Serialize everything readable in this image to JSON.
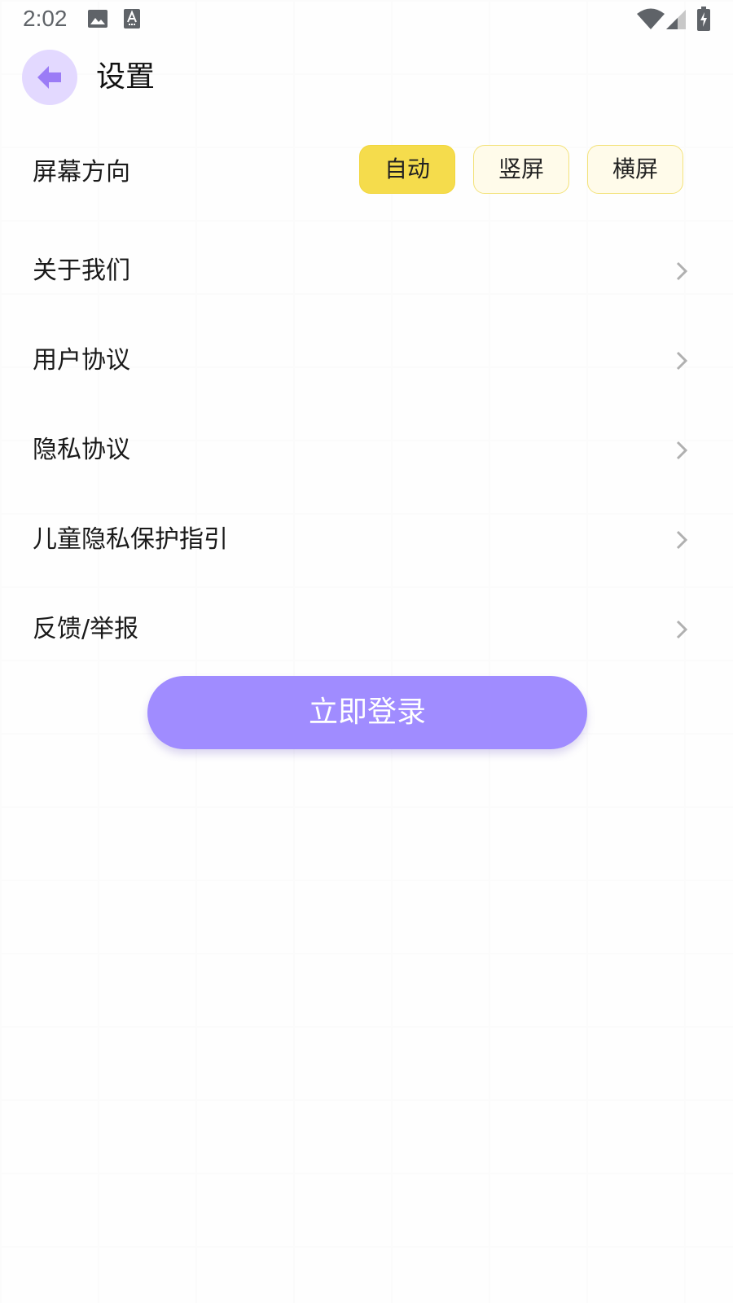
{
  "status_bar": {
    "time": "2:02",
    "icons": [
      "image-icon",
      "a-text-icon",
      "wifi-icon",
      "cell-signal-icon",
      "battery-charging-icon"
    ]
  },
  "header": {
    "back_icon": "arrow-left-icon",
    "title": "设置"
  },
  "orientation": {
    "label": "屏幕方向",
    "options": [
      "自动",
      "竖屏",
      "横屏"
    ],
    "selected": "自动"
  },
  "menu": {
    "items": [
      {
        "label": "关于我们"
      },
      {
        "label": "用户协议"
      },
      {
        "label": "隐私协议"
      },
      {
        "label": "儿童隐私保护指引"
      },
      {
        "label": "反馈/举报"
      }
    ],
    "chevron_icon": "chevron-right-icon"
  },
  "login_button": {
    "label": "立即登录"
  },
  "colors": {
    "accent_purple": "#a08cff",
    "back_circle": "#e3d9ff",
    "selected_yellow": "#f5dc4c",
    "option_bg": "#fffbea",
    "option_border": "#f3e27a"
  }
}
